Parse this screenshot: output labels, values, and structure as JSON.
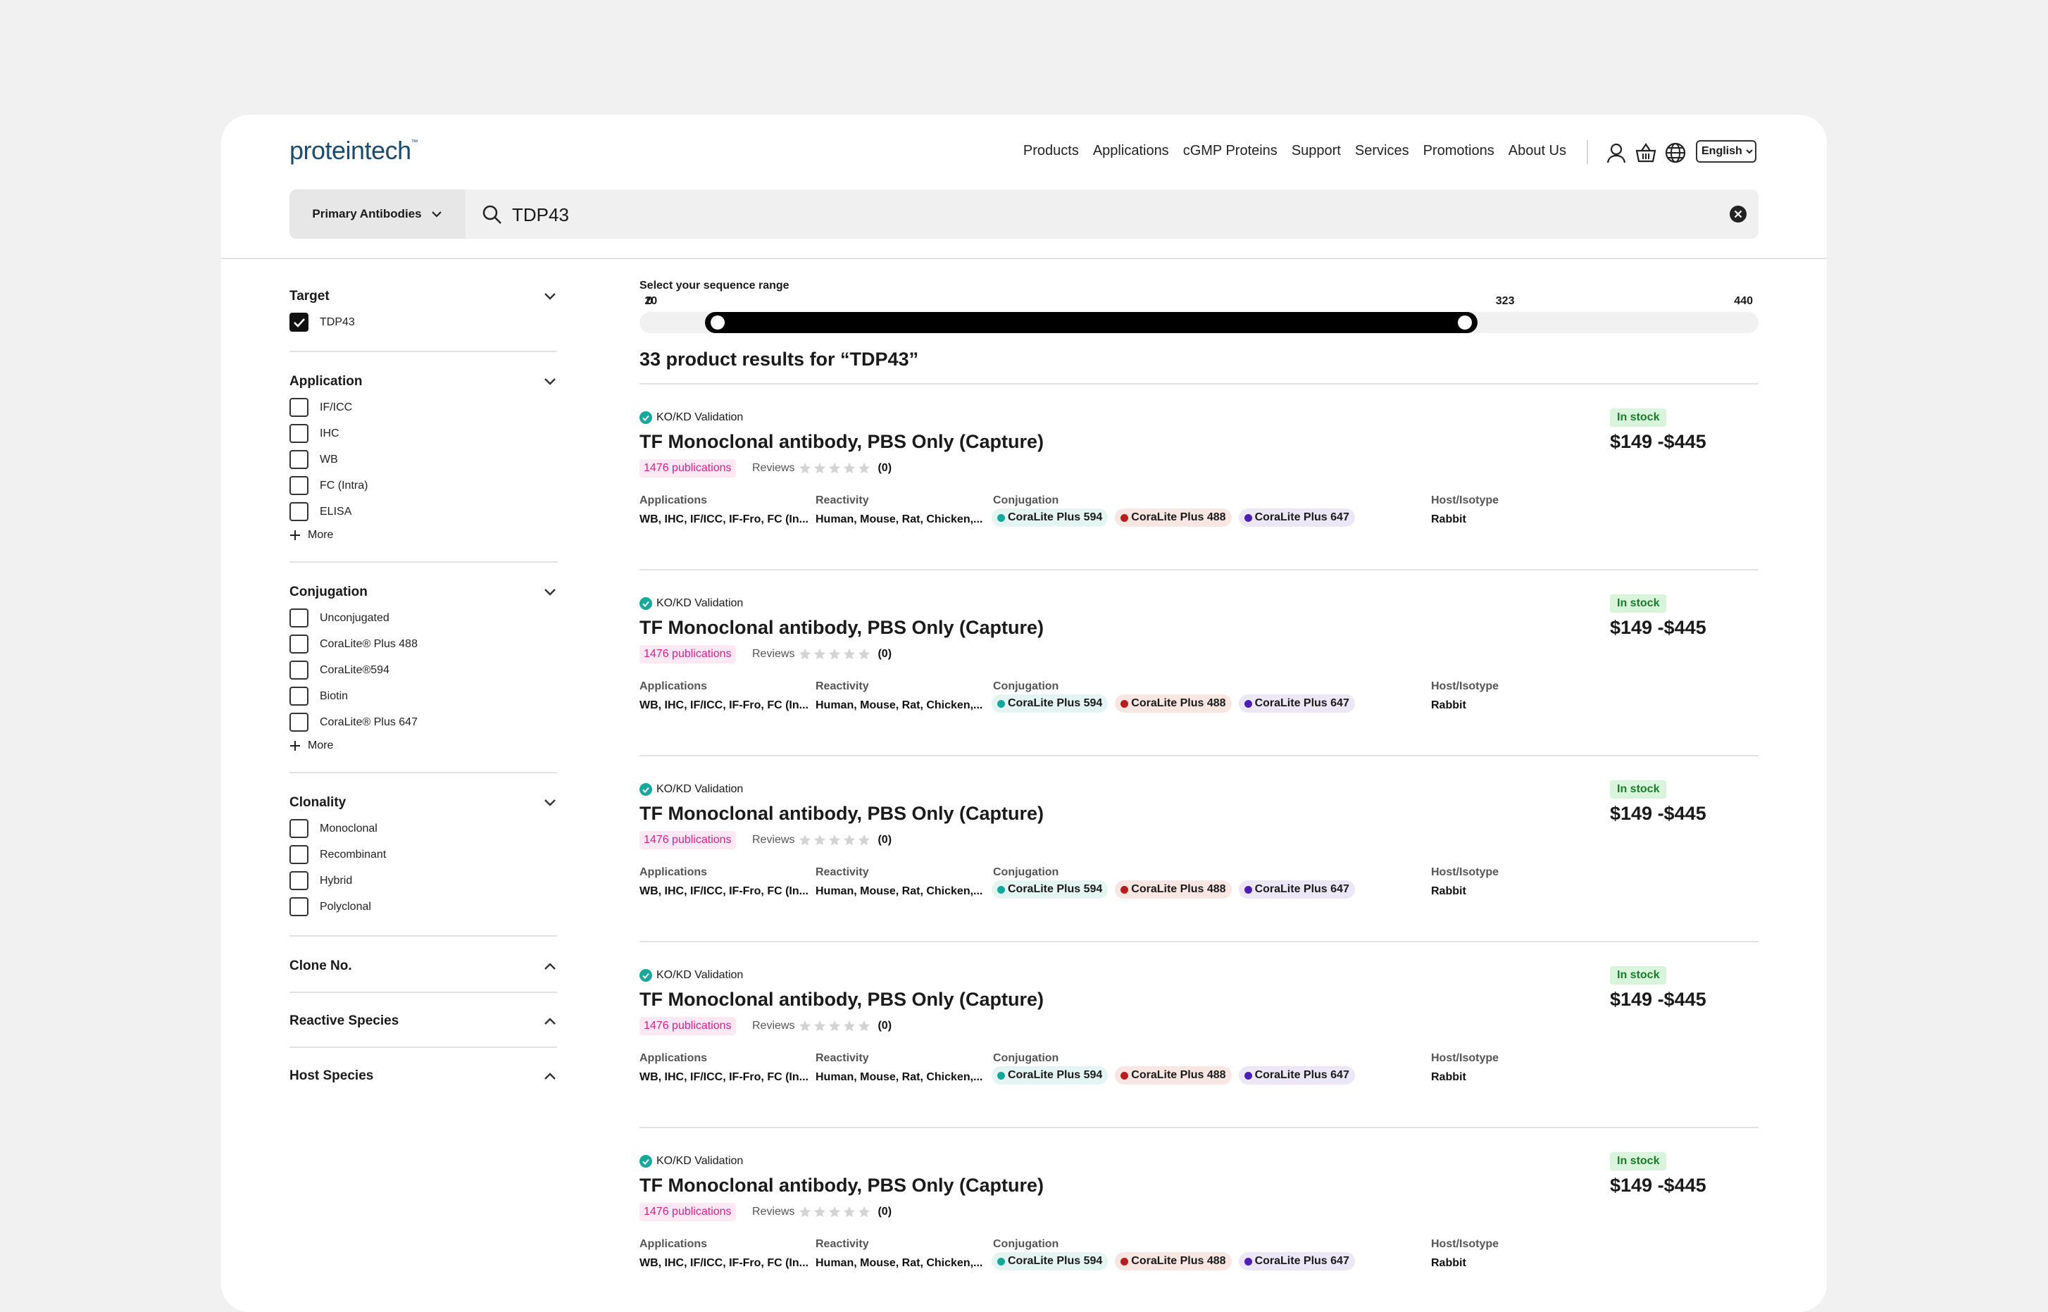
{
  "header": {
    "logo": "proteintech",
    "logo_tm": "™",
    "nav": [
      "Products",
      "Applications",
      "cGMP Proteins",
      "Support",
      "Services",
      "Promotions",
      "About Us"
    ],
    "language": "English"
  },
  "search": {
    "category": "Primary Antibodies",
    "query": "TDP43"
  },
  "filters": {
    "target": {
      "title": "Target",
      "options": [
        {
          "label": "TDP43",
          "checked": true
        }
      ]
    },
    "application": {
      "title": "Application",
      "options": [
        "IF/ICC",
        "IHC",
        "WB",
        "FC (Intra)",
        "ELISA"
      ],
      "more": "More"
    },
    "conjugation": {
      "title": "Conjugation",
      "options": [
        "Unconjugated",
        "CoraLite® Plus 488",
        "CoraLite®594",
        "Biotin",
        "CoraLite® Plus 647"
      ],
      "more": "More"
    },
    "clonality": {
      "title": "Clonality",
      "options": [
        "Monoclonal",
        "Recombinant",
        "Hybrid",
        "Polyclonal"
      ]
    },
    "clone_no": {
      "title": "Clone No."
    },
    "reactive_species": {
      "title": "Reactive Species"
    },
    "host_species": {
      "title": "Host Species"
    }
  },
  "range": {
    "title": "Select your sequence range",
    "min": 0,
    "max": 440,
    "low": 20,
    "high": 323,
    "labels": [
      "0",
      "20",
      "323",
      "440"
    ]
  },
  "results_title": "33 product results for “TDP43”",
  "product": {
    "badge": "KO/KD Validation",
    "title": "TF Monoclonal antibody, PBS Only (Capture)",
    "publications": "1476 publications",
    "reviews_label": "Reviews",
    "review_count": "(0)",
    "stock": "In stock",
    "price": "$149 -$445",
    "applications_label": "Applications",
    "applications": "WB, IHC, IF/ICC, IF-Fro, FC (In...",
    "reactivity_label": "Reactivity",
    "reactivity": "Human, Mouse, Rat, Chicken,...",
    "conjugation_label": "Conjugation",
    "host_label": "Host/Isotype",
    "host": "Rabbit",
    "chips": [
      {
        "label": "CoraLite Plus 594",
        "dot": "#17a79a",
        "bg": "#e3f4f1"
      },
      {
        "label": "CoraLite Plus 488",
        "dot": "#b81d1d",
        "bg": "#f8e6e2"
      },
      {
        "label": "CoraLite Plus 647",
        "dot": "#4b1fb5",
        "bg": "#ebe7f7"
      }
    ]
  },
  "colors": {
    "accent": "#d1238d",
    "check": "#19a89b",
    "stock_bg": "#d8f5dc",
    "stock_text": "#1b7a2c"
  }
}
